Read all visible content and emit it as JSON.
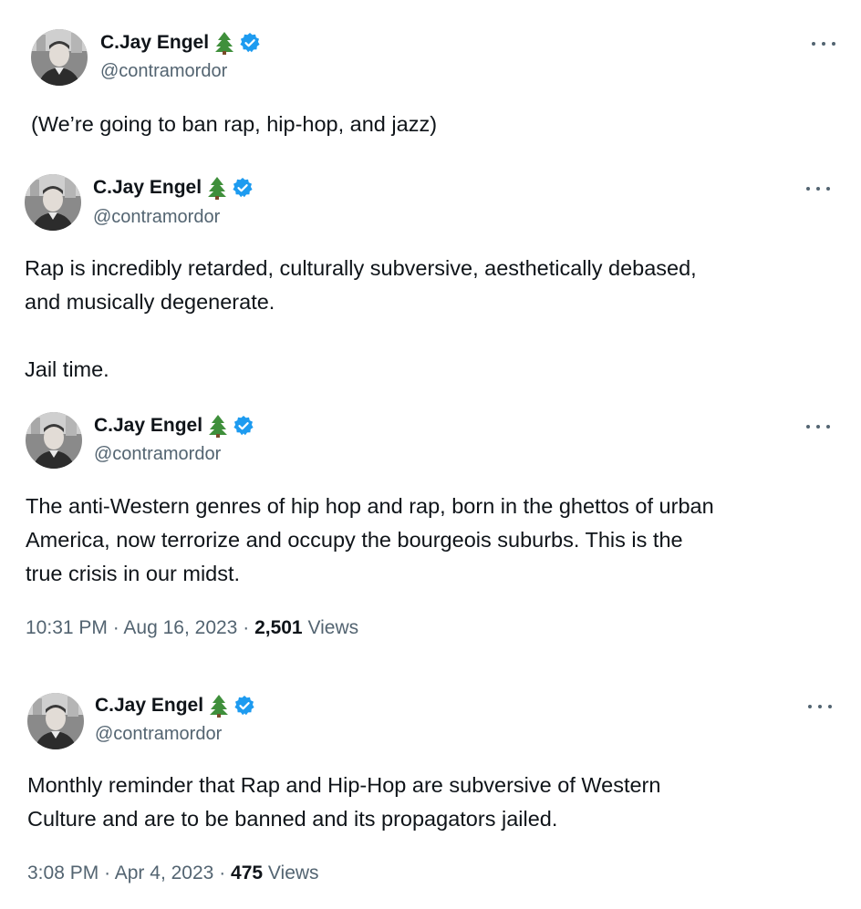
{
  "tweets": [
    {
      "author": "C.Jay Engel",
      "handle": "@contramordor",
      "text": "(We’re going to ban rap, hip-hop, and jazz)"
    },
    {
      "author": "C.Jay Engel",
      "handle": "@contramordor",
      "text": "Rap is incredibly retarded, culturally subversive, aesthetically debased,\nand musically degenerate.\n\nJail time."
    },
    {
      "author": "C.Jay Engel",
      "handle": "@contramordor",
      "text": "The anti-Western genres of hip hop and rap, born in the ghettos of urban\nAmerica, now terrorize and occupy the bourgeois suburbs. This is the\ntrue crisis in our midst.",
      "time": "10:31 PM",
      "date": "Aug 16, 2023",
      "views_count": "2,501",
      "views_label": "Views"
    },
    {
      "author": "C.Jay Engel",
      "handle": "@contramordor",
      "text": "Monthly reminder that Rap and Hip-Hop are subversive of Western\nCulture and are to be banned and its propagators jailed.",
      "time": "3:08 PM",
      "date": "Apr 4, 2023",
      "views_count": "475",
      "views_label": "Views"
    }
  ],
  "separator": "·",
  "icons": {
    "tree": "evergreen-tree-icon",
    "verified": "verified-badge-icon",
    "more": "more-options-icon"
  },
  "colors": {
    "verified": "#1d9bf0",
    "secondary_text": "#536471",
    "primary_text": "#0f1419"
  }
}
